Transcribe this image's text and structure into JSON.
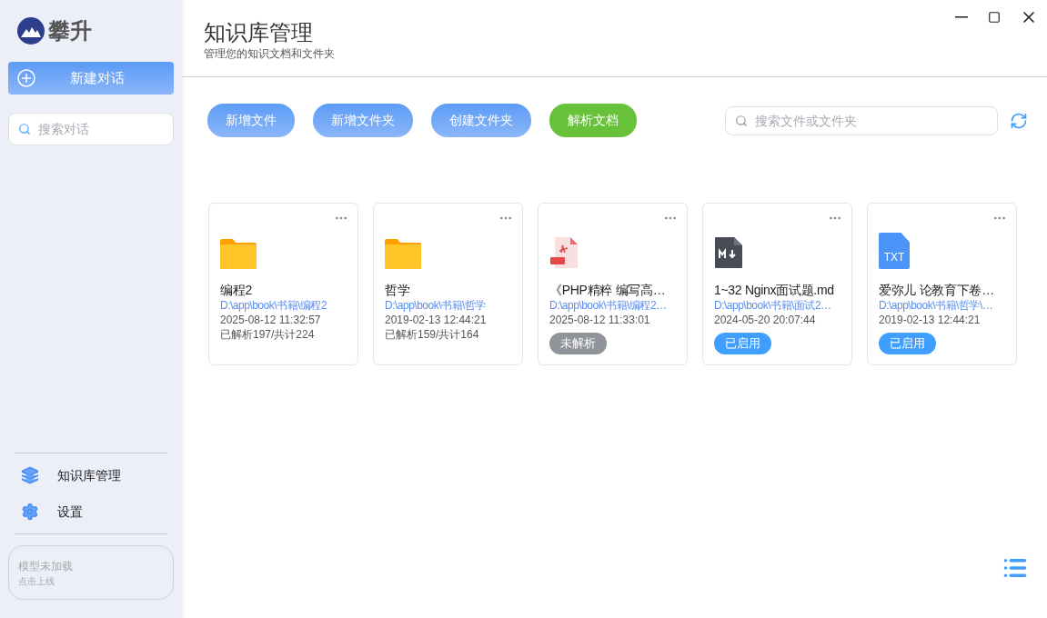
{
  "sidebar": {
    "logo_text": "攀升",
    "new_chat_button": "新建对话",
    "search": {
      "placeholder": "搜索对话"
    },
    "nav_items": [
      {
        "kind": "layers",
        "label": "知识库管理"
      },
      {
        "kind": "settings",
        "label": "设置"
      }
    ],
    "model_status": {
      "title": "模型未加载",
      "subtitle": "点击上线"
    }
  },
  "header": {
    "title": "知识库管理",
    "subtitle": "管理您的知识文档和文件夹"
  },
  "toolbar": {
    "buttons": [
      {
        "label": "新增文件",
        "kind": "primary"
      },
      {
        "label": "新增文件夹",
        "kind": "primary"
      },
      {
        "label": "创建文件夹",
        "kind": "primary"
      },
      {
        "label": "解析文档",
        "kind": "success"
      }
    ],
    "search": {
      "placeholder": "搜索文件或文件夹"
    }
  },
  "cards": [
    {
      "kind": "folder",
      "name": "编程2",
      "path": "D:\\app\\book\\书籍\\编程2",
      "time": "2025-08-12 11:32:57",
      "progress": "已解析197/共计224"
    },
    {
      "kind": "folder",
      "name": "哲学",
      "path": "D:\\app\\book\\书籍\\哲学",
      "time": "2019-02-13 12:44:21",
      "progress": "已解析159/共计164"
    },
    {
      "kind": "pdf",
      "name": "《PHP精粹 编写高…",
      "path": "D:\\app\\book\\书籍\\编程2…",
      "time": "2025-08-12 11:33:01",
      "status": {
        "kind": "unparsed",
        "label": "未解析"
      }
    },
    {
      "kind": "md",
      "name": "1~32 Nginx面试题.md",
      "path": "D:\\app\\book\\书籍\\面试2…",
      "time": "2024-05-20 20:07:44",
      "status": {
        "kind": "enabled",
        "label": "已启用"
      }
    },
    {
      "kind": "txt",
      "name": "爱弥儿 论教育下卷…",
      "path": "D:\\app\\book\\书籍\\哲学\\…",
      "time": "2019-02-13 12:44:21",
      "icon_text": "TXT",
      "status": {
        "kind": "enabled",
        "label": "已启用"
      }
    }
  ]
}
